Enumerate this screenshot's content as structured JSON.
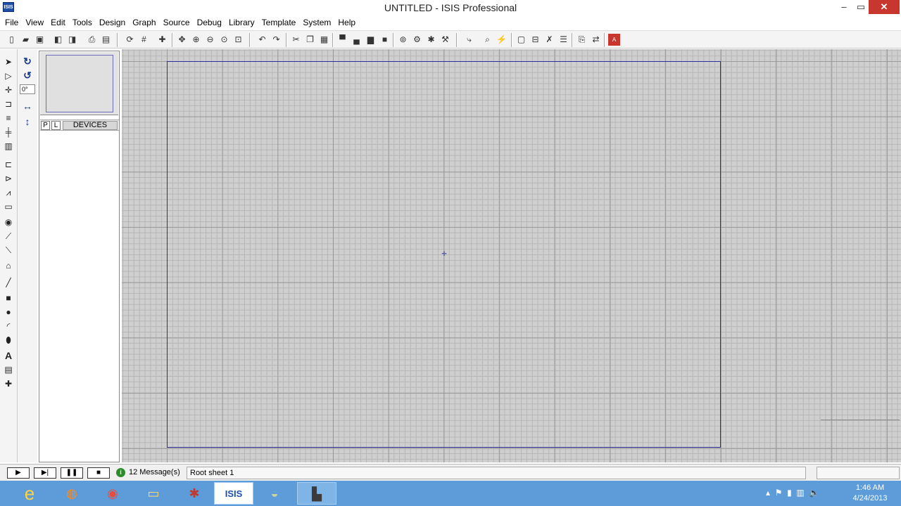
{
  "window": {
    "title": "UNTITLED - ISIS Professional",
    "app_icon": "ISIS",
    "min": "–",
    "max": "▭",
    "close": "✕"
  },
  "menu": [
    "File",
    "View",
    "Edit",
    "Tools",
    "Design",
    "Graph",
    "Source",
    "Debug",
    "Library",
    "Template",
    "System",
    "Help"
  ],
  "toolbar_icons": [
    "new-icon",
    "open-icon",
    "save-icon",
    "import-icon",
    "export-icon",
    "print-icon",
    "print-area-icon",
    "refresh-icon",
    "grid-icon",
    "origin-icon",
    "pan-icon",
    "zoom-in-icon",
    "zoom-out-icon",
    "zoom-all-icon",
    "zoom-area-icon",
    "undo-icon",
    "redo-icon",
    "cut-icon",
    "copy-icon",
    "paste-icon",
    "block-copy-icon",
    "block-move-icon",
    "block-rotate-icon",
    "block-delete-icon",
    "pick-device-icon",
    "make-device-icon",
    "packaging-icon",
    "decompose-icon",
    "wire-autoroute-icon",
    "search-tag-icon",
    "property-tool-icon",
    "new-sheet-icon",
    "remove-sheet-icon",
    "exit-parent-icon",
    "bom-icon",
    "erc-icon",
    "netlist-icon",
    "ares-icon"
  ],
  "rotation": {
    "value": "0°"
  },
  "device_panel": {
    "p_label": "P",
    "l_label": "L",
    "title": "DEVICES"
  },
  "status": {
    "messages": "12 Message(s)",
    "sheet": "Root sheet 1"
  },
  "taskbar": {
    "time": "1:46 AM",
    "date": "4/24/2013",
    "isis_label": "ISIS"
  }
}
